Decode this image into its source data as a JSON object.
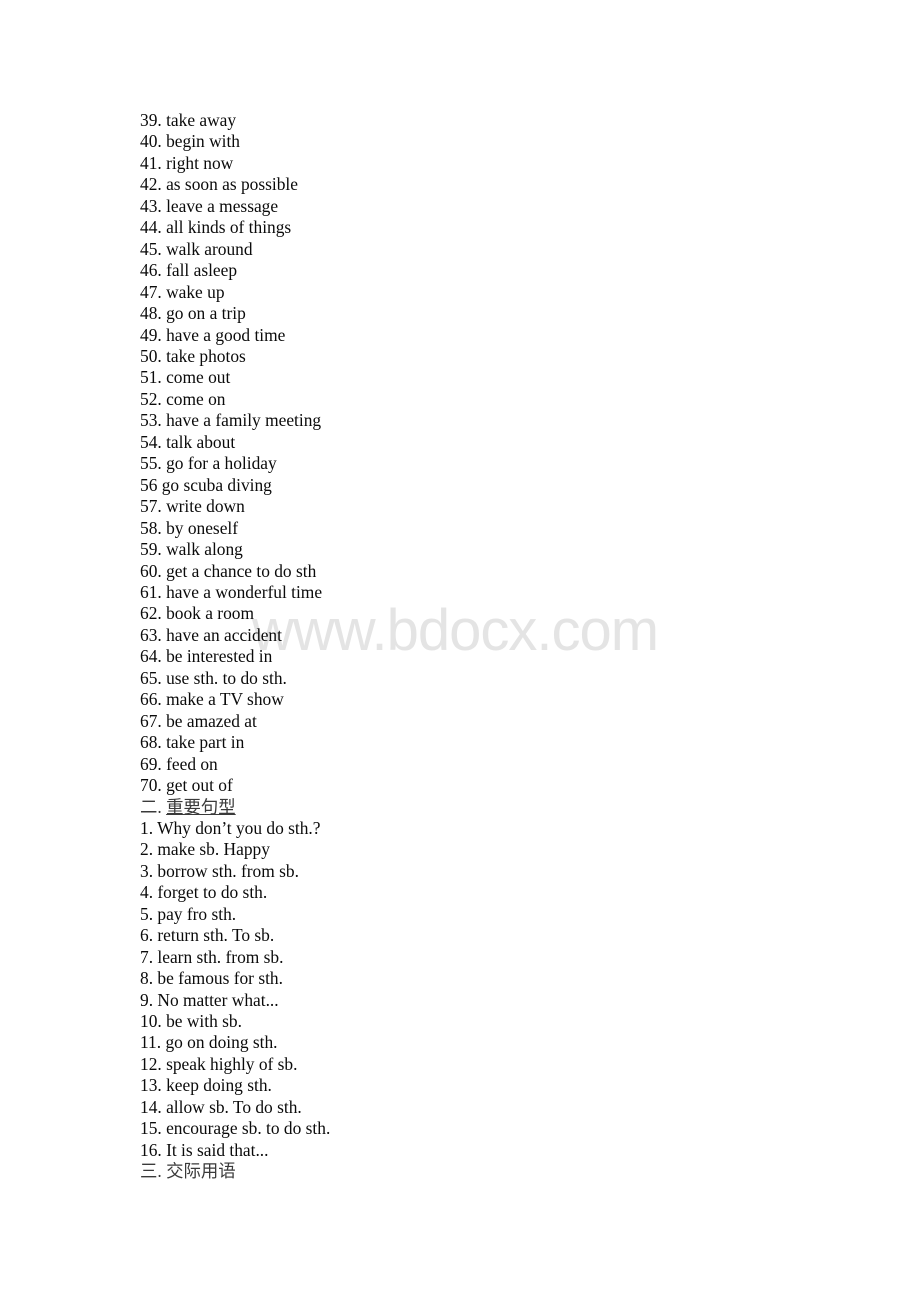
{
  "page": {
    "watermark": "www.bdocx.com",
    "watermark_color": "#e4e4e4",
    "background_color": "#ffffff",
    "text_color": "#0b0b0b",
    "heading_color": "#3a3a3a"
  },
  "phrases_section": {
    "items": [
      "39. take away",
      "40. begin with",
      "41. right now",
      "42. as soon as possible",
      "43. leave a message",
      "44. all kinds of things",
      "45. walk around",
      "46. fall asleep",
      "47. wake up",
      "48. go on a trip",
      "49. have a good time",
      "50. take photos",
      "51. come out",
      "52. come on",
      "53. have a family meeting",
      "54. talk about",
      "55. go for a holiday",
      "56 go scuba diving",
      "57. write down",
      "58. by oneself",
      "59. walk along",
      "60. get a chance to do sth",
      "61. have a wonderful time",
      "62. book a room",
      "63. have an accident",
      "64. be interested in",
      "65. use sth. to do sth.",
      "66. make a TV show",
      "67. be amazed at",
      "68. take part in",
      "69. feed on",
      "70. get out of"
    ]
  },
  "patterns_section": {
    "heading_number": "二.",
    "heading_title": "重要句型",
    "items": [
      "1. Why don’t you do sth.?",
      "2. make sb. Happy",
      "3. borrow sth. from sb.",
      "4. forget to do sth.",
      "5. pay fro sth.",
      "6. return sth. To sb.",
      "7. learn sth. from sb.",
      "8. be famous for sth.",
      "9. No matter what...",
      "10. be with sb.",
      "11. go on doing sth.",
      "12. speak highly of sb.",
      "13. keep doing sth.",
      "14. allow sb. To do sth.",
      "15. encourage sb. to do sth.",
      "16. It is said that..."
    ]
  },
  "communication_section": {
    "heading_number": "三.",
    "heading_title": "交际用语"
  }
}
